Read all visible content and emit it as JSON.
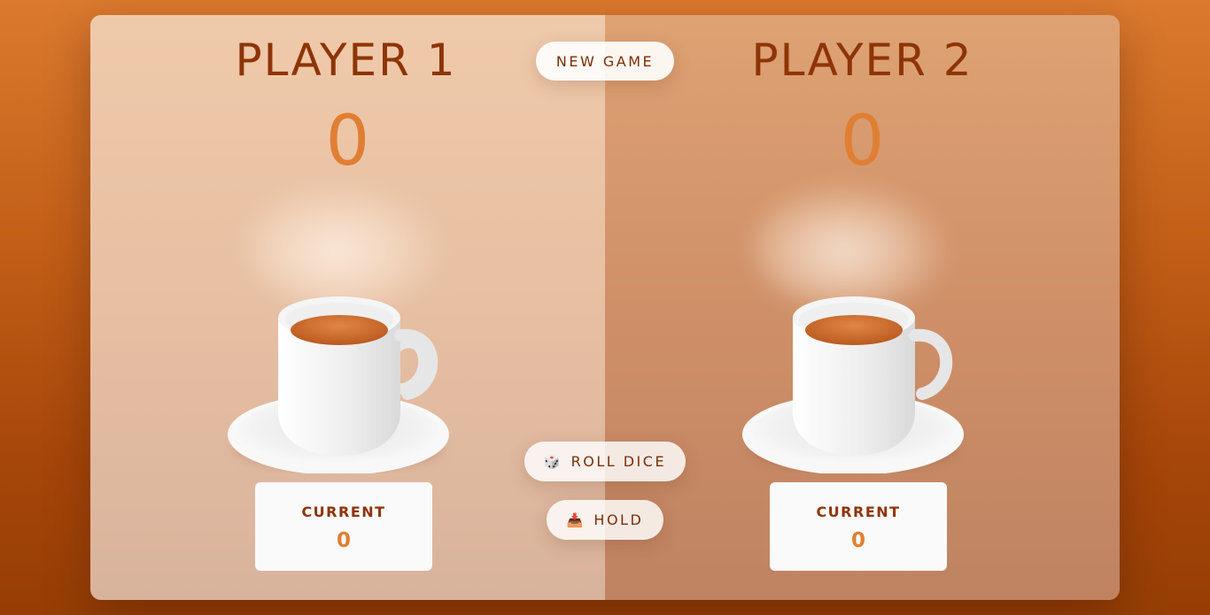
{
  "players": [
    {
      "name": "PLAYER 1",
      "score": "0",
      "current_label": "CURRENT",
      "current_value": "0"
    },
    {
      "name": "PLAYER 2",
      "score": "0",
      "current_label": "CURRENT",
      "current_value": "0"
    }
  ],
  "controls": {
    "new_game": "NEW GAME",
    "roll_dice": "ROLL DICE",
    "roll_dice_icon": "🎲",
    "hold": "HOLD",
    "hold_icon": "📥"
  },
  "colors": {
    "name_text": "#8e3406",
    "score_text": "#e07f33",
    "page_background": "#c25e17"
  },
  "icons": {
    "roll_dice": "dice-icon",
    "hold": "inbox-tray-icon",
    "player_image": "coffee-cup-icon"
  }
}
